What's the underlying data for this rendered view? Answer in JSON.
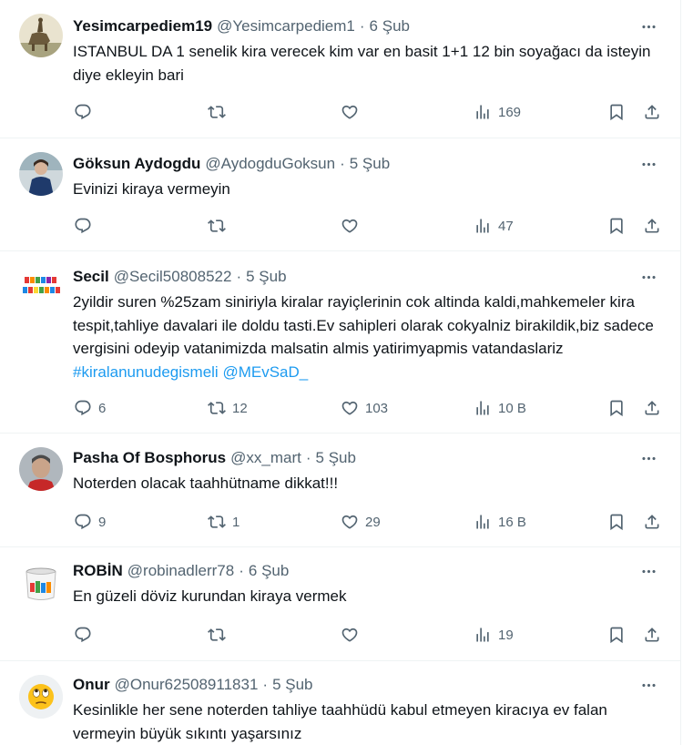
{
  "tweets": [
    {
      "name": "Yesimcarpediem19",
      "handle": "@Yesimcarpediem1",
      "dot": "·",
      "time": "6 Şub",
      "text": "ISTANBUL DA 1 senelik kira verecek kim var en basit 1+1 12 bin soyağacı da isteyin diye ekleyin bari",
      "replies": "",
      "retweets": "",
      "likes": "",
      "views": "169",
      "avatar_icon": "statue-avatar"
    },
    {
      "name": "Göksun Aydogdu",
      "handle": "@AydogduGoksun",
      "dot": "·",
      "time": "5 Şub",
      "text": "Evinizi kiraya vermeyin",
      "replies": "",
      "retweets": "",
      "likes": "",
      "views": "47",
      "avatar_icon": "person-avatar"
    },
    {
      "name": "Secil",
      "handle": "@Secil50808522",
      "dot": "·",
      "time": "5 Şub",
      "text_plain": "2yildir suren %25zam siniriyla kiralar rayiçlerinin cok altinda kaldi,mahkemeler kira tespit,tahliye davalari ile doldu tasti.Ev sahipleri olarak cokyalniz birakildik,biz sadece vergisini odeyip vatanimizda malsatin almis yatirimyapmis vatandaslariz",
      "hashtag": "#kiralanunudegismeli",
      "mention": "@MEvSaD_",
      "replies": "6",
      "retweets": "12",
      "likes": "103",
      "views": "10 B",
      "avatar_icon": "english-teacher-logo"
    },
    {
      "name": "Pasha Of Bosphorus",
      "handle": "@xx_mart",
      "dot": "·",
      "time": "5 Şub",
      "text": "Noterden olacak taahhütname dikkat!!!",
      "replies": "9",
      "retweets": "1",
      "likes": "29",
      "views": "16 B",
      "avatar_icon": "man-avatar"
    },
    {
      "name": "ROBİN",
      "handle": "@robinadlerr78",
      "dot": "·",
      "time": "6 Şub",
      "text": "En güzeli döviz kurundan kiraya vermek",
      "replies": "",
      "retweets": "",
      "likes": "",
      "views": "19",
      "avatar_icon": "bucket-avatar"
    },
    {
      "name": "Onur",
      "handle": "@Onur62508911831",
      "dot": "·",
      "time": "5 Şub",
      "text": "Kesinlikle her sene noterden tahliye taahhüdü kabul etmeyen kiracıya ev falan vermeyin büyük sıkıntı yaşarsınız",
      "replies": "",
      "retweets": "",
      "likes": "",
      "views": "",
      "avatar_icon": "rolling-eyes-emoji-avatar"
    }
  ],
  "colors": {
    "text": "#0f1419",
    "secondary": "#536471",
    "link": "#1d9bf0",
    "divider": "#eff3f4"
  }
}
